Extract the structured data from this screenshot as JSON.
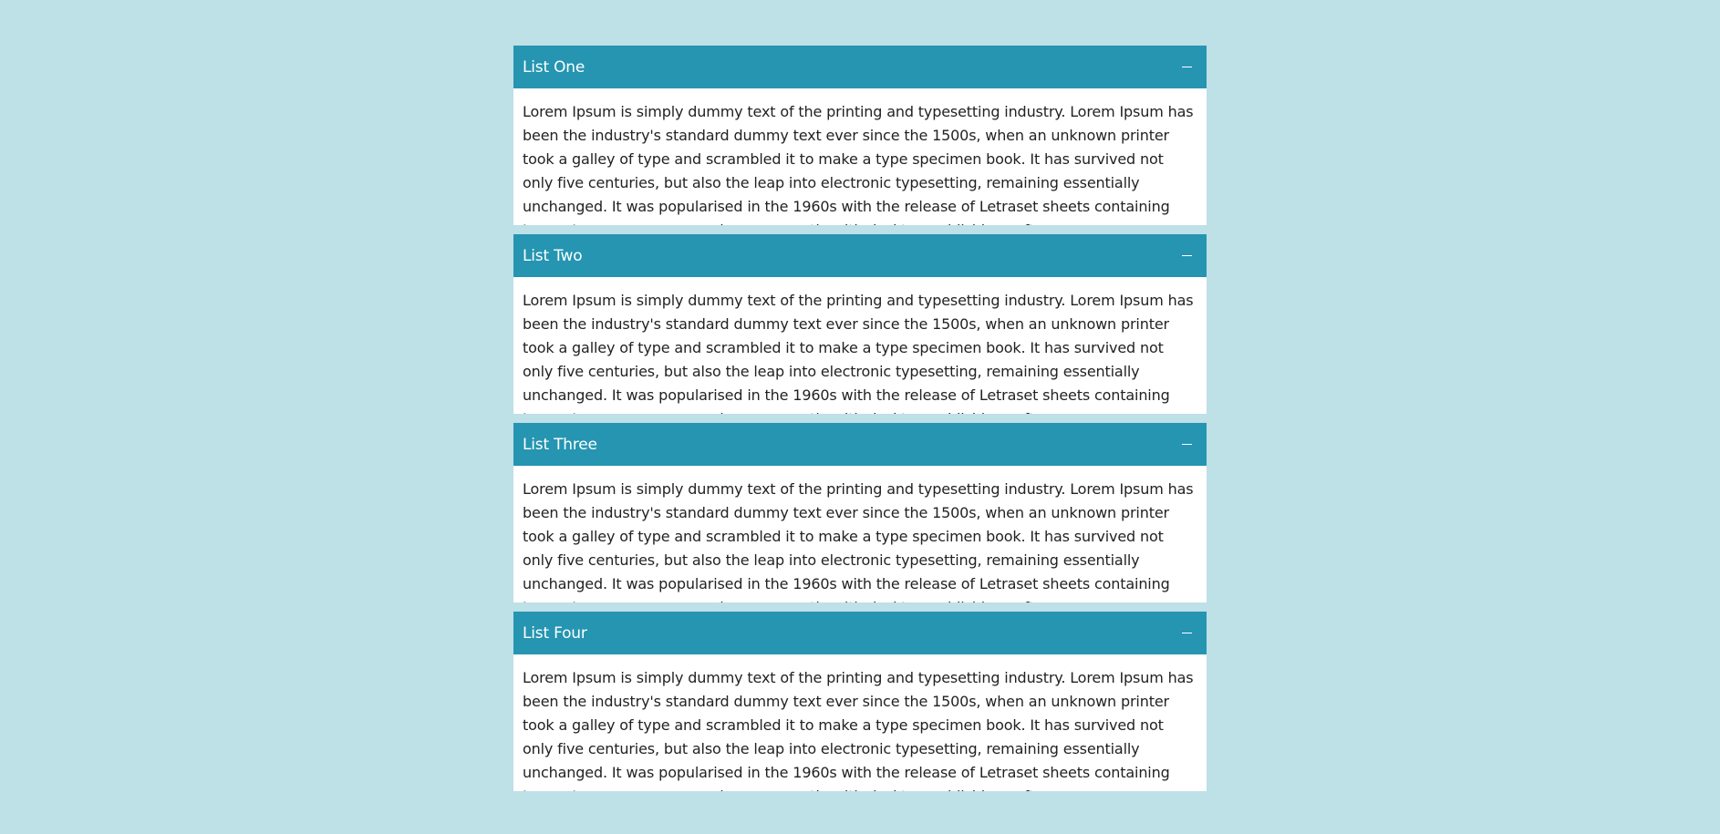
{
  "accordion": {
    "items": [
      {
        "title": "List One",
        "toggle_icon": "minus-icon",
        "body": "Lorem Ipsum is simply dummy text of the printing and typesetting industry. Lorem Ipsum has been the industry's standard dummy text ever since the 1500s, when an unknown printer took a galley of type and scrambled it to make a type specimen book. It has survived not only five centuries, but also the leap into electronic typesetting, remaining essentially unchanged. It was popularised in the 1960s with the release of Letraset sheets containing Lorem Ipsum passages, and more recently with desktop publishing software"
      },
      {
        "title": "List Two",
        "toggle_icon": "minus-icon",
        "body": "Lorem Ipsum is simply dummy text of the printing and typesetting industry. Lorem Ipsum has been the industry's standard dummy text ever since the 1500s, when an unknown printer took a galley of type and scrambled it to make a type specimen book. It has survived not only five centuries, but also the leap into electronic typesetting, remaining essentially unchanged. It was popularised in the 1960s with the release of Letraset sheets containing Lorem Ipsum passages, and more recently with desktop publishing software"
      },
      {
        "title": "List Three",
        "toggle_icon": "minus-icon",
        "body": "Lorem Ipsum is simply dummy text of the printing and typesetting industry. Lorem Ipsum has been the industry's standard dummy text ever since the 1500s, when an unknown printer took a galley of type and scrambled it to make a type specimen book. It has survived not only five centuries, but also the leap into electronic typesetting, remaining essentially unchanged. It was popularised in the 1960s with the release of Letraset sheets containing Lorem Ipsum passages, and more recently with desktop publishing software"
      },
      {
        "title": "List Four",
        "toggle_icon": "minus-icon",
        "body": "Lorem Ipsum is simply dummy text of the printing and typesetting industry. Lorem Ipsum has been the industry's standard dummy text ever since the 1500s, when an unknown printer took a galley of type and scrambled it to make a type specimen book. It has survived not only five centuries, but also the leap into electronic typesetting, remaining essentially unchanged. It was popularised in the 1960s with the release of Letraset sheets containing Lorem Ipsum passages, and more recently with desktop publishing software"
      }
    ]
  },
  "colors": {
    "page_background": "#bee0e7",
    "header_background": "#2595b1",
    "header_text": "#ffffff",
    "body_background": "#ffffff",
    "body_text": "#222222"
  }
}
